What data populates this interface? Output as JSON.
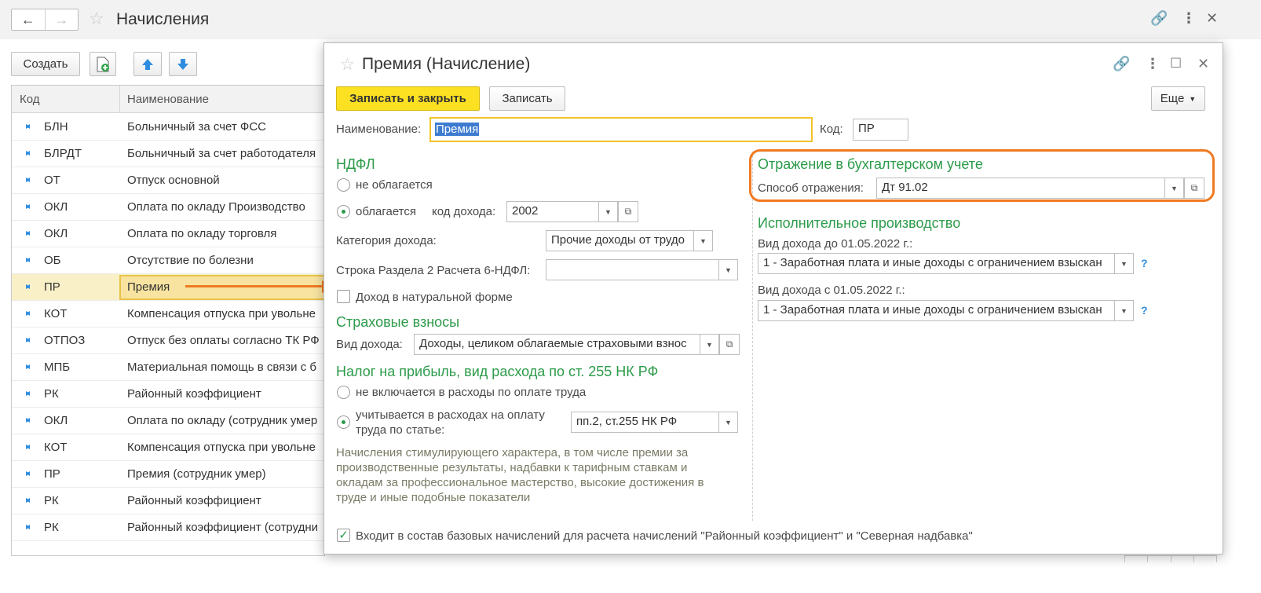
{
  "window": {
    "title": "Начисления",
    "create_label": "Создать"
  },
  "list": {
    "headers": {
      "code": "Код",
      "name": "Наименование"
    },
    "rows": [
      {
        "code": "БЛН",
        "name": "Больничный за счет ФСС"
      },
      {
        "code": "БЛРДТ",
        "name": "Больничный за счет работодателя"
      },
      {
        "code": "ОТ",
        "name": "Отпуск основной"
      },
      {
        "code": "ОКЛ",
        "name": "Оплата по окладу Производство"
      },
      {
        "code": "ОКЛ",
        "name": "Оплата по окладу торговля"
      },
      {
        "code": "ОБ",
        "name": "Отсутствие по болезни"
      },
      {
        "code": "ПР",
        "name": "Премия"
      },
      {
        "code": "КОТ",
        "name": "Компенсация отпуска при увольне"
      },
      {
        "code": "ОТПОЗ",
        "name": "Отпуск без оплаты согласно ТК РФ"
      },
      {
        "code": "МПБ",
        "name": "Материальная помощь в связи с б"
      },
      {
        "code": "РК",
        "name": "Районный коэффициент"
      },
      {
        "code": "ОКЛ",
        "name": "Оплата по окладу (сотрудник умер"
      },
      {
        "code": "КОТ",
        "name": "Компенсация отпуска при увольне"
      },
      {
        "code": "ПР",
        "name": "Премия (сотрудник умер)"
      },
      {
        "code": "РК",
        "name": "Районный коэффициент"
      },
      {
        "code": "РК",
        "name": "Районный коэффициент (сотрудни"
      }
    ],
    "selected_index": 6
  },
  "dialog": {
    "title": "Премия (Начисление)",
    "save_close_label": "Записать и закрыть",
    "save_label": "Записать",
    "more_label": "Еще",
    "name_label": "Наименование:",
    "name_value": "Премия",
    "code_label": "Код:",
    "code_value": "ПР",
    "ndfl": {
      "title": "НДФЛ",
      "not_taxed": "не облагается",
      "taxed": "облагается",
      "income_code_label": "код дохода:",
      "income_code_value": "2002",
      "category_label": "Категория дохода:",
      "category_value": "Прочие доходы от трудо",
      "line_label": "Строка Раздела 2 Расчета 6-НДФЛ:",
      "line_value": "",
      "natural_label": "Доход в натуральной форме"
    },
    "insurance": {
      "title": "Страховые взносы",
      "income_type_label": "Вид дохода:",
      "income_type_value": "Доходы, целиком облагаемые страховыми взнос"
    },
    "profit_tax": {
      "title": "Налог на прибыль, вид расхода по ст. 255 НК РФ",
      "excluded": "не включается в расходы по оплате труда",
      "included_line1": "учитывается в расходах на оплату",
      "included_line2": "труда по статье:",
      "article_value": "пп.2, ст.255 НК РФ",
      "note": "Начисления стимулирующего характера, в том числе премии за производственные результаты, надбавки к тарифным ставкам и окладам за профессиональное мастерство, высокие достижения в труде и иные подобные показатели"
    },
    "accounting": {
      "title": "Отражение в бухгалтерском учете",
      "method_label": "Способ отражения:",
      "method_value": "Дт 91.02"
    },
    "enforcement": {
      "title": "Исполнительное производство",
      "before_label": "Вид дохода до 01.05.2022 г.:",
      "before_value": "1 - Заработная плата и иные доходы с ограничением взыскан",
      "after_label": "Вид дохода с 01.05.2022 г.:",
      "after_value": "1 - Заработная плата и иные доходы с ограничением взыскан",
      "help": "?"
    },
    "base_accruals_label": "Входит в состав базовых начислений для расчета начислений \"Районный коэффициент\" и \"Северная надбавка\""
  },
  "colors": {
    "accent_yellow": "#fce123",
    "section_green": "#2c9b4a",
    "highlight_orange": "#f07a22",
    "selection_blue": "#3d7bd1"
  }
}
